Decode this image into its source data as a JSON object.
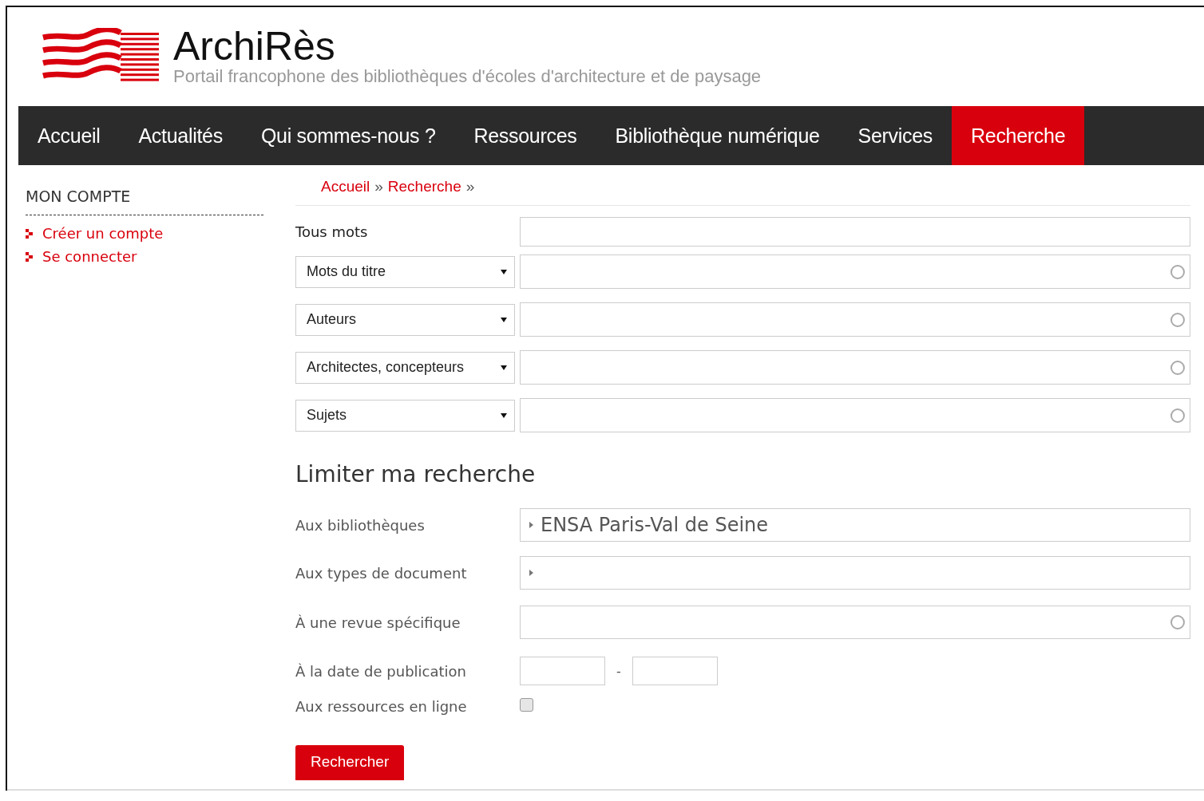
{
  "header": {
    "title": "ArchiRès",
    "tagline": "Portail francophone des bibliothèques d'écoles d'architecture et de paysage"
  },
  "nav": [
    {
      "label": "Accueil",
      "selected": false
    },
    {
      "label": "Actualités",
      "selected": false
    },
    {
      "label": "Qui sommes-nous ?",
      "selected": false
    },
    {
      "label": "Ressources",
      "selected": false
    },
    {
      "label": "Bibliothèque numérique",
      "selected": false
    },
    {
      "label": "Services",
      "selected": false
    },
    {
      "label": "Recherche",
      "selected": true
    }
  ],
  "sidebar": {
    "title": "MON COMPTE",
    "links": [
      "Créer un compte",
      "Se connecter"
    ]
  },
  "breadcrumb": [
    {
      "kind": "link",
      "text": "Accueil"
    },
    {
      "kind": "separator",
      "text": "»"
    },
    {
      "kind": "link",
      "text": "Recherche"
    },
    {
      "kind": "separator",
      "text": "»"
    }
  ],
  "search_rows": [
    {
      "kind": "label",
      "label": "Tous mots",
      "autocomplete": false
    },
    {
      "kind": "select",
      "label": "Mots du titre",
      "autocomplete": true
    },
    {
      "kind": "select",
      "label": "Auteurs",
      "autocomplete": true
    },
    {
      "kind": "select",
      "label": "Architectes, concepteurs",
      "autocomplete": true
    },
    {
      "kind": "select",
      "label": "Sujets",
      "autocomplete": true
    }
  ],
  "limits": {
    "title": "Limiter ma recherche",
    "rows": [
      {
        "kind": "tree",
        "label": "Aux bibliothèques",
        "value": "ENSA Paris-Val de Seine"
      },
      {
        "kind": "tree",
        "label": "Aux types de document"
      },
      {
        "kind": "autocomplete",
        "label": "À une revue spécifique"
      },
      {
        "kind": "date_range",
        "label": "À la date de publication",
        "separator": "-"
      },
      {
        "kind": "checkbox",
        "label": "Aux ressources en ligne",
        "checked": false
      }
    ]
  },
  "submit": "Rechercher"
}
